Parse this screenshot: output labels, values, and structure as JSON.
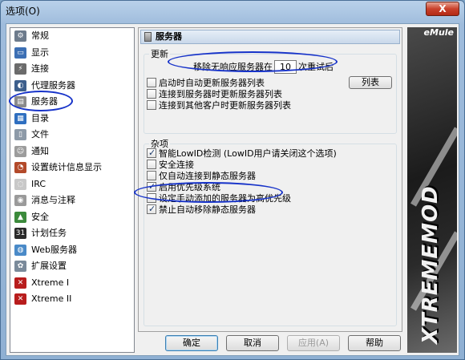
{
  "window": {
    "title": "选项(O)",
    "close_label": "X"
  },
  "sidebar": {
    "items": [
      {
        "label": "常规",
        "icon": "gear-icon",
        "color": "#6d7b8c",
        "glyph": "⚙"
      },
      {
        "label": "显示",
        "icon": "monitor-icon",
        "color": "#3c6fb4",
        "glyph": "▭"
      },
      {
        "label": "连接",
        "icon": "plug-icon",
        "color": "#6b6b6b",
        "glyph": "⚡"
      },
      {
        "label": "代理服务器",
        "icon": "proxy-icon",
        "color": "#3d5f8c",
        "glyph": "◐"
      },
      {
        "label": "服务器",
        "icon": "server-icon",
        "color": "#8a8a8a",
        "glyph": "▤"
      },
      {
        "label": "目录",
        "icon": "folder-icon",
        "color": "#2f6fc0",
        "glyph": "▦"
      },
      {
        "label": "文件",
        "icon": "file-icon",
        "color": "#8d9aa8",
        "glyph": "▯"
      },
      {
        "label": "通知",
        "icon": "notify-icon",
        "color": "#9c9c9c",
        "glyph": "☺"
      },
      {
        "label": "设置统计信息显示",
        "icon": "stats-icon",
        "color": "#b34a2a",
        "glyph": "◔"
      },
      {
        "label": "IRC",
        "icon": "irc-icon",
        "color": "#c8c8c8",
        "glyph": "◌"
      },
      {
        "label": "消息与注释",
        "icon": "message-icon",
        "color": "#9a9a9a",
        "glyph": "◉"
      },
      {
        "label": "安全",
        "icon": "shield-icon",
        "color": "#3b8a3b",
        "glyph": "▲"
      },
      {
        "label": "计划任务",
        "icon": "calendar-icon",
        "color": "#2b2b2b",
        "glyph": "31"
      },
      {
        "label": "Web服务器",
        "icon": "globe-icon",
        "color": "#4a8ac8",
        "glyph": "◍"
      },
      {
        "label": "扩展设置",
        "icon": "extension-icon",
        "color": "#7a8a9a",
        "glyph": "✿"
      },
      {
        "label": "Xtreme I",
        "icon": "xtreme-icon",
        "color": "#b81d1d",
        "glyph": "✕"
      },
      {
        "label": "Xtreme II",
        "icon": "xtreme-icon",
        "color": "#b81d1d",
        "glyph": "✕"
      }
    ]
  },
  "panel": {
    "header": "服务器",
    "update_group": {
      "legend": "更新",
      "retry_prefix": "移除无响应服务器在",
      "retry_value": "10",
      "retry_suffix": "次重试后",
      "list_button": "列表",
      "options": [
        {
          "label": "启动时自动更新服务器列表",
          "checked": false
        },
        {
          "label": "连接到服务器时更新服务器列表",
          "checked": false
        },
        {
          "label": "连接到其他客户时更新服务器列表",
          "checked": false
        }
      ]
    },
    "misc_group": {
      "legend": "杂项",
      "options": [
        {
          "label": "智能LowID检测 (LowID用户请关闭这个选项)",
          "checked": true
        },
        {
          "label": "安全连接",
          "checked": false
        },
        {
          "label": "仅自动连接到静态服务器",
          "checked": false
        },
        {
          "label": "启用优先级系统",
          "checked": true
        },
        {
          "label": "设定手动添加的服务器为高优先级",
          "checked": false
        },
        {
          "label": "禁止自动移除静态服务器",
          "checked": true
        }
      ]
    }
  },
  "banner": {
    "top_label": "eMule",
    "brand_text": "XTREMEMOD"
  },
  "buttons": {
    "ok": "确定",
    "cancel": "取消",
    "apply": "应用(A)",
    "help": "帮助"
  },
  "colors": {
    "highlight_ellipse": "#1733c9",
    "title_bar": "#9fbcdc"
  }
}
